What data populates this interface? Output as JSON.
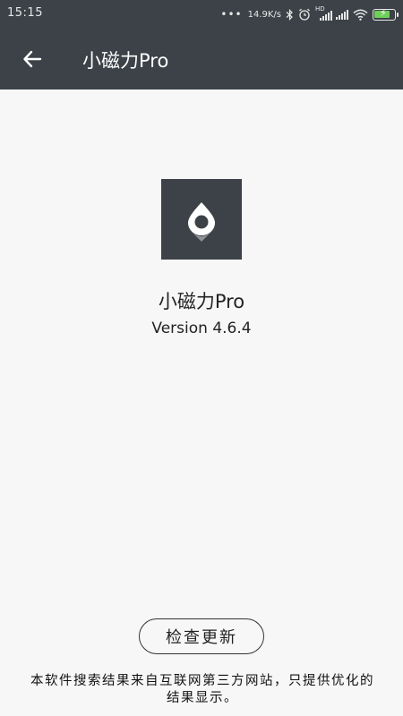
{
  "status_bar": {
    "time": "15:15",
    "network_speed": "14.9K/s",
    "hd_label": "HD",
    "icons": [
      "dots-icon",
      "bluetooth-icon",
      "alarm-icon",
      "hd-signal-icon",
      "signal-icon",
      "wifi-icon",
      "battery-charging-icon"
    ],
    "battery_color": "#6fcf5b"
  },
  "app_bar": {
    "back_icon": "arrow-left-icon",
    "title": "小磁力Pro",
    "background": "#3c4247"
  },
  "about": {
    "logo_icon": "map-pin-icon",
    "app_name": "小磁力Pro",
    "version": "Version 4.6.4"
  },
  "actions": {
    "check_update_label": "检查更新"
  },
  "disclaimer": "本软件搜索结果来自互联网第三方网站，只提供优化的结果显示。"
}
